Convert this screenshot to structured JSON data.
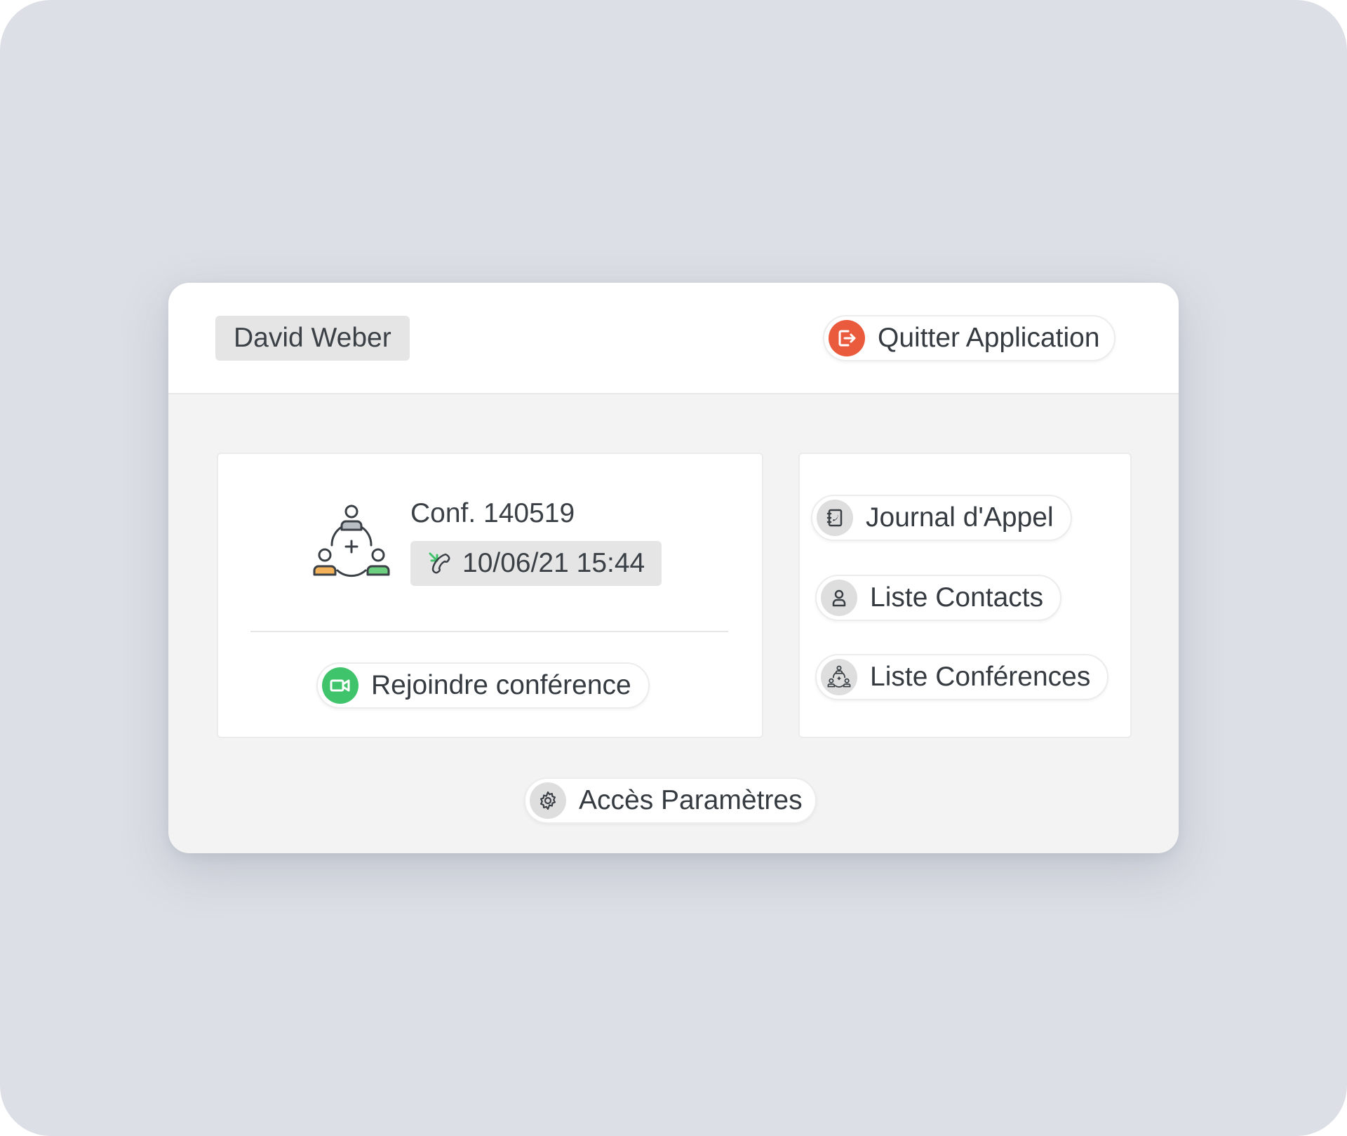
{
  "header": {
    "user_name": "David Weber",
    "quit_label": "Quitter Application",
    "quit_icon": "exit-icon",
    "quit_color": "#ea5a3c"
  },
  "conference": {
    "title": "Conf. 140519",
    "datetime": "10/06/21 15:44",
    "call_icon": "incoming-call-icon",
    "join_label": "Rejoindre conférence",
    "join_icon": "video-camera-icon",
    "join_color": "#3fc46b"
  },
  "menu": {
    "items": [
      {
        "label": "Journal d'Appel",
        "icon": "call-log-icon"
      },
      {
        "label": "Liste Contacts",
        "icon": "person-icon"
      },
      {
        "label": "Liste Conférences",
        "icon": "conference-icon"
      }
    ]
  },
  "footer": {
    "settings_label": "Accès Paramètres",
    "settings_icon": "gear-icon"
  }
}
